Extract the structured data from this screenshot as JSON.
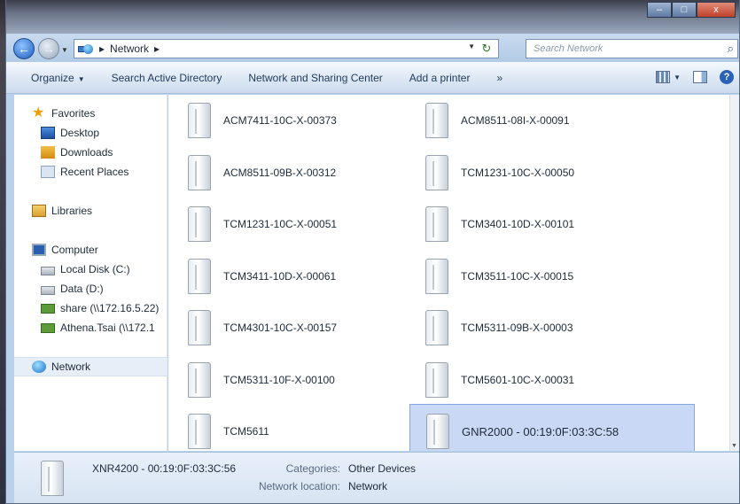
{
  "window": {
    "minimize_glyph": "–",
    "maximize_glyph": "□",
    "close_glyph": "x"
  },
  "address": {
    "crumb_sep": "▸",
    "location": "Network",
    "search_placeholder": "Search Network"
  },
  "toolbar": {
    "organize": "Organize",
    "search_ad": "Search Active Directory",
    "network_sharing": "Network and Sharing Center",
    "add_printer": "Add a printer",
    "more": "»"
  },
  "sidebar": {
    "favorites": "Favorites",
    "desktop": "Desktop",
    "downloads": "Downloads",
    "recent_places": "Recent Places",
    "libraries": "Libraries",
    "computer": "Computer",
    "local_disk": "Local Disk (C:)",
    "data_disk": "Data (D:)",
    "share": "share (\\\\172.16.5.22)",
    "athena": "Athena.Tsai (\\\\172.1",
    "network": "Network"
  },
  "devices": [
    "ACM7411-10C-X-00373",
    "ACM8511-08I-X-00091",
    "ACM8511-09B-X-00312",
    "TCM1231-10C-X-00050",
    "TCM1231-10C-X-00051",
    "TCM3401-10D-X-00101",
    "TCM3411-10D-X-00061",
    "TCM3511-10C-X-00015",
    "TCM4301-10C-X-00157",
    "TCM5311-09B-X-00003",
    "TCM5311-10F-X-00100",
    "TCM5601-10C-X-00031",
    "TCM5611",
    "GNR2000 - 00:19:0F:03:3C:58"
  ],
  "details": {
    "name": "XNR4200   - 00:19:0F:03:3C:56",
    "categories_label": "Categories:",
    "categories_value": "Other Devices",
    "location_label": "Network location:",
    "location_value": "Network"
  }
}
